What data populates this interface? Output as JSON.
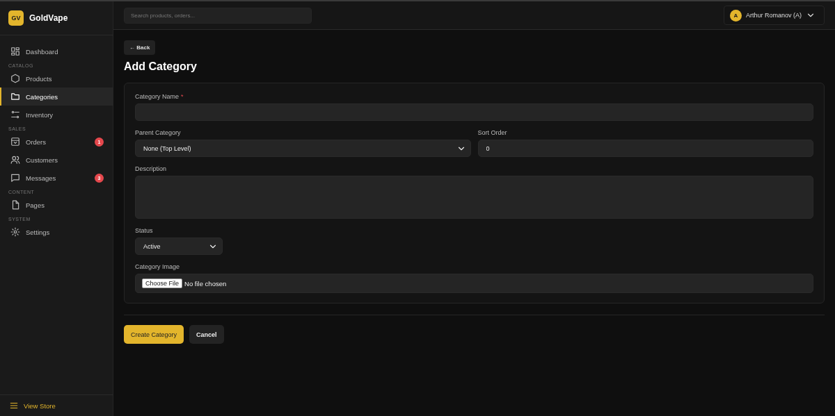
{
  "brand": {
    "logo": "GV",
    "name": "GoldVape"
  },
  "sidebar": {
    "sections": [
      {
        "items": [
          {
            "label": "Dashboard",
            "selected": false
          }
        ]
      },
      {
        "title": "CATALOG",
        "items": [
          {
            "label": "Products",
            "selected": false
          },
          {
            "label": "Categories",
            "selected": true
          },
          {
            "label": "Inventory",
            "selected": false
          }
        ]
      },
      {
        "title": "SALES",
        "items": [
          {
            "label": "Orders",
            "selected": false,
            "badge": "1"
          },
          {
            "label": "Customers",
            "selected": false
          },
          {
            "label": "Messages",
            "selected": false,
            "badge": "3"
          }
        ]
      },
      {
        "title": "CONTENT",
        "items": [
          {
            "label": "Pages",
            "selected": false
          }
        ]
      },
      {
        "title": "SYSTEM",
        "items": [
          {
            "label": "Settings",
            "selected": false
          }
        ]
      }
    ],
    "footer_link": "View Store"
  },
  "topbar": {
    "search": {
      "placeholder": "Search products, orders..."
    },
    "user": {
      "avatar": "A",
      "name": "Arthur Romanov (A)"
    }
  },
  "page": {
    "back": "← Back",
    "title": "Add Category",
    "form": [
      {
        "kind": "text",
        "label": "Category Name",
        "required_mark": "*"
      },
      {
        "kind": "select",
        "label": "Parent Category",
        "value": "None (Top Level)",
        "half": true
      },
      {
        "kind": "number",
        "label": "Sort Order",
        "value": "0",
        "half": true
      },
      {
        "kind": "textarea",
        "label": "Description"
      },
      {
        "kind": "select",
        "label": "Status",
        "value": "Active",
        "narrow": true
      },
      {
        "kind": "file",
        "label": "Category Image",
        "button": "Choose File",
        "value": "No file chosen"
      }
    ],
    "buttons": [
      {
        "label": "Create Category",
        "kind": "primary"
      },
      {
        "label": "Cancel",
        "kind": "secondary"
      }
    ]
  }
}
